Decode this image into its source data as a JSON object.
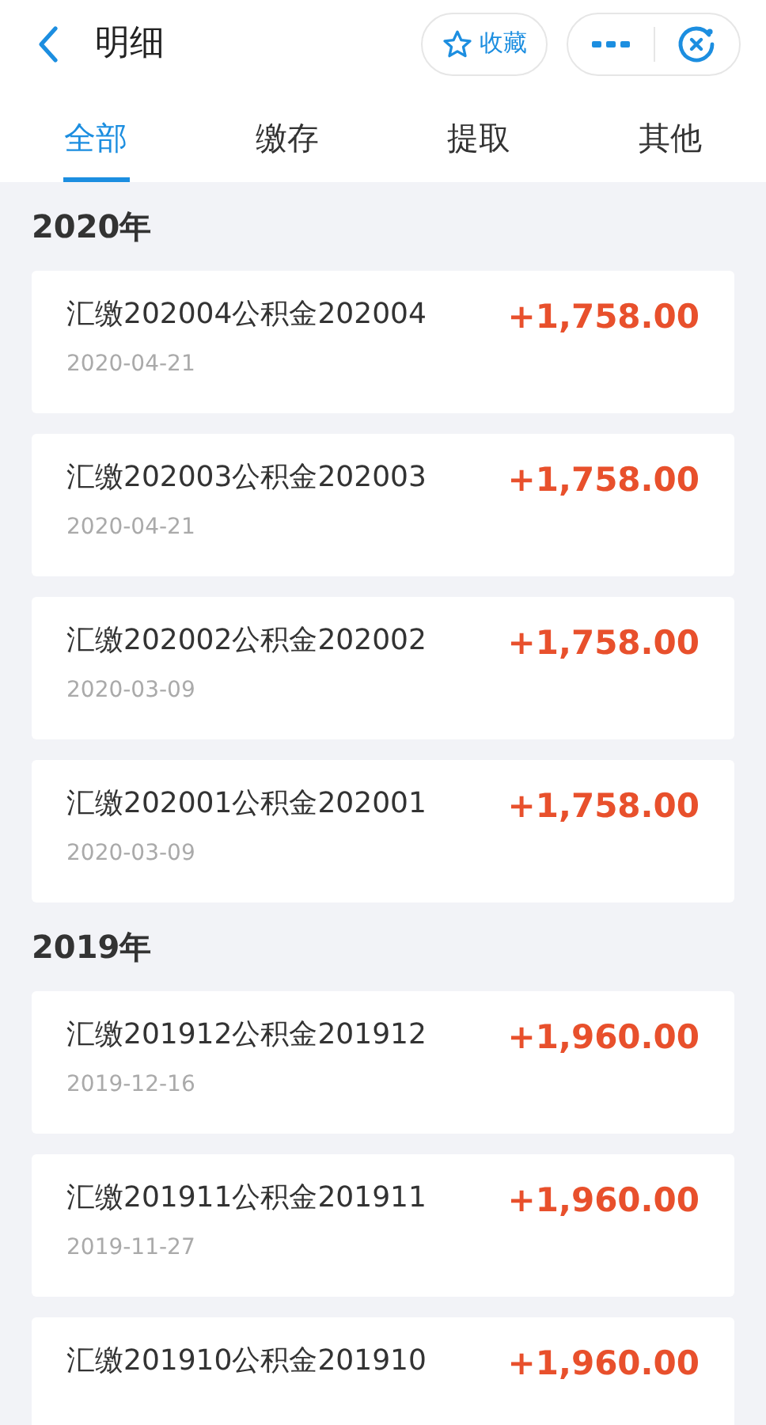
{
  "header": {
    "title": "明细",
    "favorite_label": "收藏"
  },
  "tabs": [
    {
      "label": "全部",
      "selected": true
    },
    {
      "label": "缴存",
      "selected": false
    },
    {
      "label": "提取",
      "selected": false
    },
    {
      "label": "其他",
      "selected": false
    }
  ],
  "groups": [
    {
      "year": "2020年",
      "records": [
        {
          "title": "汇缴202004公积金202004",
          "date": "2020-04-21",
          "amount": "+1,758.00"
        },
        {
          "title": "汇缴202003公积金202003",
          "date": "2020-04-21",
          "amount": "+1,758.00"
        },
        {
          "title": "汇缴202002公积金202002",
          "date": "2020-03-09",
          "amount": "+1,758.00"
        },
        {
          "title": "汇缴202001公积金202001",
          "date": "2020-03-09",
          "amount": "+1,758.00"
        }
      ]
    },
    {
      "year": "2019年",
      "records": [
        {
          "title": "汇缴201912公积金201912",
          "date": "2019-12-16",
          "amount": "+1,960.00"
        },
        {
          "title": "汇缴201911公积金201911",
          "date": "2019-11-27",
          "amount": "+1,960.00"
        },
        {
          "title": "汇缴201910公积金201910",
          "amount": "+1,960.00"
        }
      ]
    }
  ]
}
